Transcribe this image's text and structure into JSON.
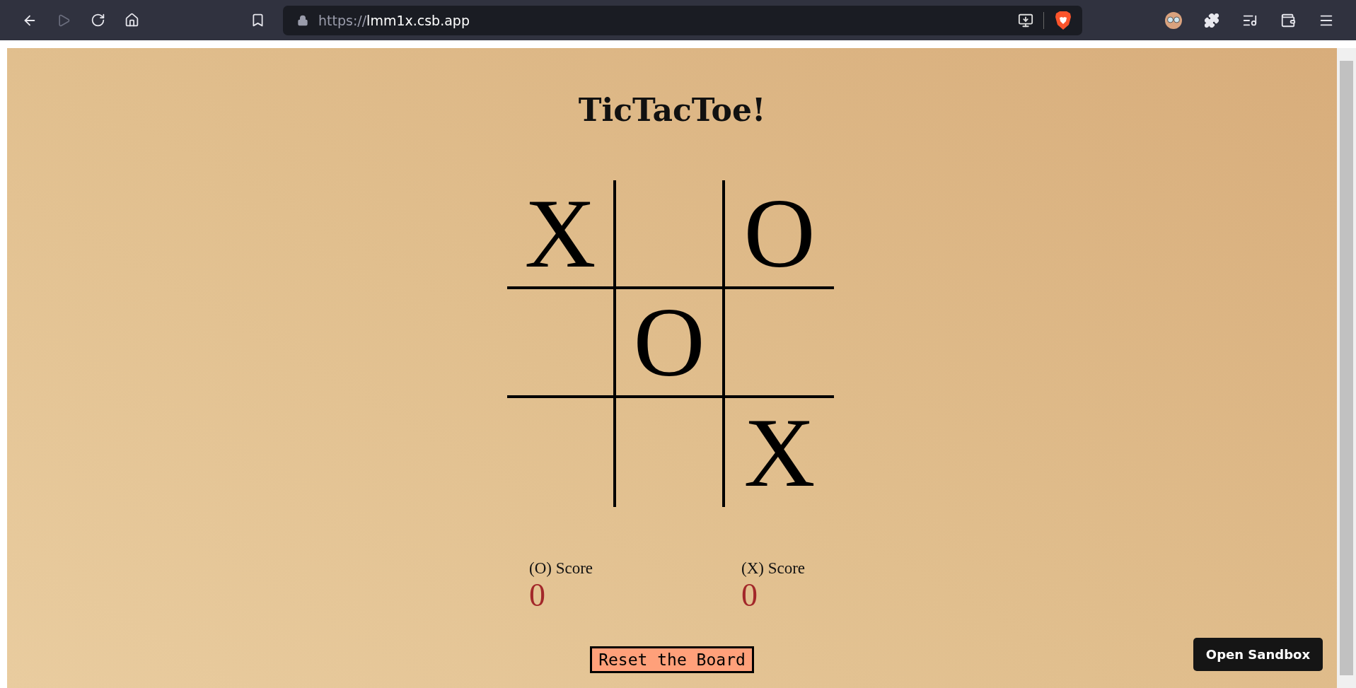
{
  "browser": {
    "url_scheme": "https://",
    "url_host": "lmm1x.csb.app"
  },
  "title": "TicTacToe!",
  "board": [
    {
      "kind": "marked",
      "mark": "X"
    },
    {
      "kind": "empty"
    },
    {
      "kind": "marked",
      "mark": "O"
    },
    {
      "kind": "empty"
    },
    {
      "kind": "marked",
      "mark": "O"
    },
    {
      "kind": "empty"
    },
    {
      "kind": "empty"
    },
    {
      "kind": "empty"
    },
    {
      "kind": "marked",
      "mark": "X"
    }
  ],
  "scores": [
    {
      "label": "(O) Score",
      "value": "0"
    },
    {
      "label": "(X) Score",
      "value": "0"
    }
  ],
  "reset_button": "Reset the Board",
  "open_sandbox": "Open Sandbox"
}
